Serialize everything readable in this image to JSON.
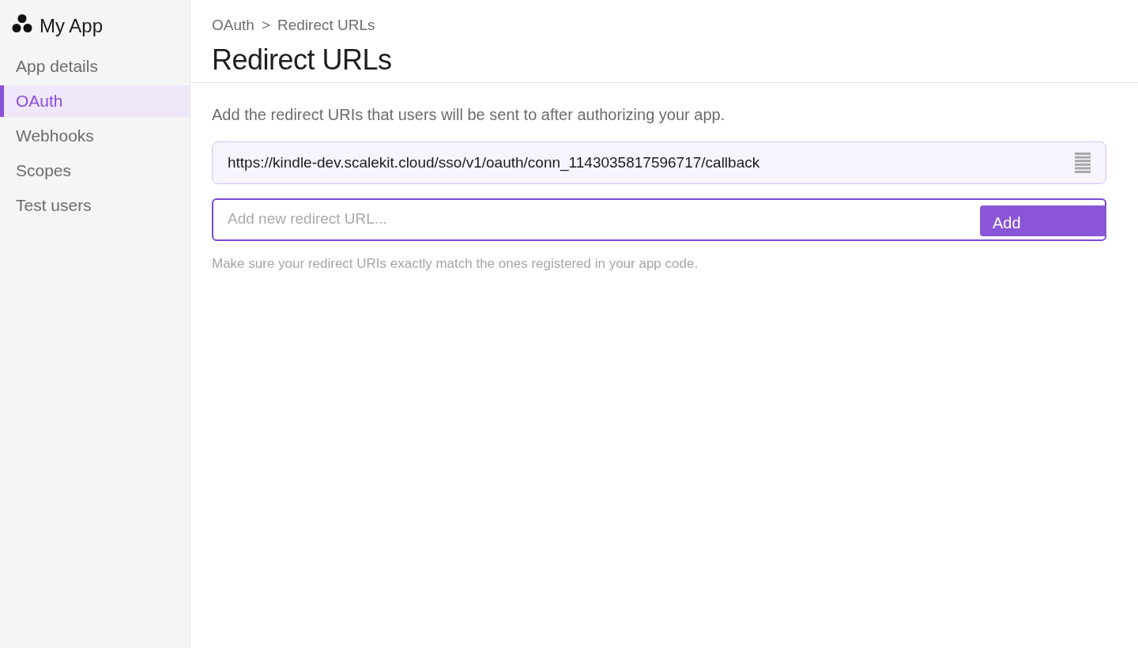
{
  "app": {
    "name": "My App"
  },
  "sidebar": {
    "items": [
      {
        "label": "App details",
        "selected": false
      },
      {
        "label": "OAuth",
        "selected": true
      },
      {
        "label": "Webhooks",
        "selected": false
      },
      {
        "label": "Scopes",
        "selected": false
      },
      {
        "label": "Test users",
        "selected": false
      }
    ]
  },
  "breadcrumb": {
    "items": [
      "OAuth",
      "Redirect URLs"
    ],
    "separator": ">"
  },
  "page": {
    "title": "Redirect URLs",
    "description": "Add the redirect URIs that users will be sent to after authorizing your app.",
    "redirect_urls": [
      "https://kindle-dev.scalekit.cloud/sso/v1/oauth/conn_1143035817596717/callback"
    ],
    "new_url_field": {
      "placeholder": "Add new redirect URL..."
    },
    "add_button": "Add",
    "hint": "Make sure your redirect URIs exactly match the ones registered in your app code."
  }
}
